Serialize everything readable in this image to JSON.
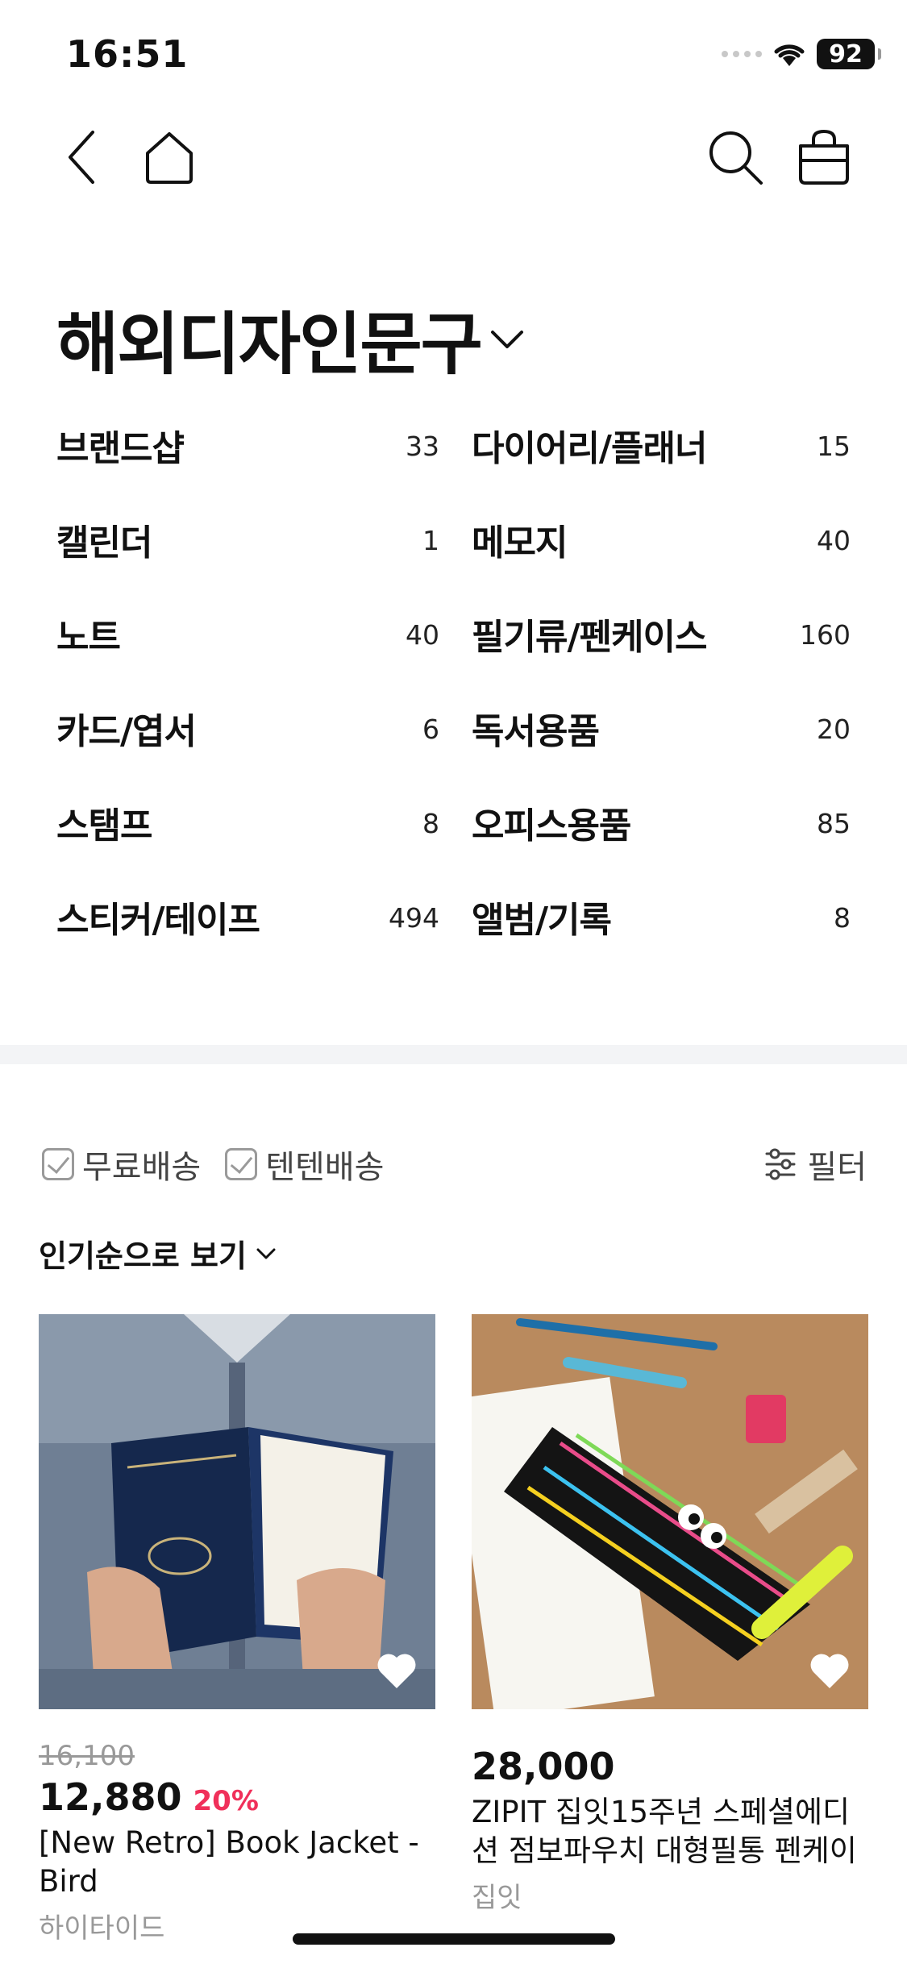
{
  "status_bar": {
    "time": "16:51",
    "battery": "92"
  },
  "nav": {
    "back_icon": "chevron-left-icon",
    "home_icon": "home-icon",
    "search_icon": "search-icon",
    "bag_icon": "shopping-bag-icon"
  },
  "category": {
    "title": "해외디자인문구"
  },
  "subcategories": [
    {
      "label": "브랜드샵",
      "count": "33"
    },
    {
      "label": "다이어리/플래너",
      "count": "15"
    },
    {
      "label": "캘린더",
      "count": "1"
    },
    {
      "label": "메모지",
      "count": "40"
    },
    {
      "label": "노트",
      "count": "40"
    },
    {
      "label": "필기류/펜케이스",
      "count": "160"
    },
    {
      "label": "카드/엽서",
      "count": "6"
    },
    {
      "label": "독서용품",
      "count": "20"
    },
    {
      "label": "스탬프",
      "count": "8"
    },
    {
      "label": "오피스용품",
      "count": "85"
    },
    {
      "label": "스티커/테이프",
      "count": "494"
    },
    {
      "label": "앨범/기록",
      "count": "8"
    }
  ],
  "filters": {
    "free_shipping": "무료배송",
    "tenten_shipping": "텐텐배송",
    "filter_label": "필터"
  },
  "sort": {
    "label": "인기순으로 보기"
  },
  "products": [
    {
      "original_price": "16,100",
      "price": "12,880",
      "discount": "20%",
      "name": "[New Retro] Book Jacket - Bird",
      "brand": "하이타이드"
    },
    {
      "price": "28,000",
      "name": "ZIPIT 집잇15주년 스페셜에디션 점보파우치 대형필통 펜케이",
      "brand": "집잇"
    }
  ],
  "colors": {
    "accent": "#f0305a",
    "muted": "#999999"
  }
}
